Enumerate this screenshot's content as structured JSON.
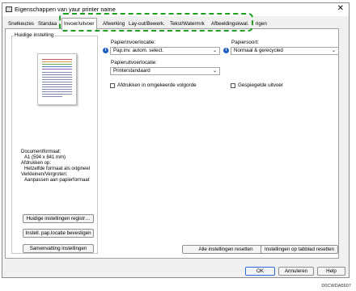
{
  "window": {
    "title": "Eigenschappen van уаur printer name",
    "close_symbol": "✕"
  },
  "tabs": [
    {
      "label": "Snelkeuzes"
    },
    {
      "label": "Standaa"
    },
    {
      "label": "Invoer/uitvoer"
    },
    {
      "label": "Afwerking"
    },
    {
      "label": "Lay-out/Bewerk."
    },
    {
      "label": "Tekst/Watermrk"
    },
    {
      "label": "Afbeeldingskwal."
    },
    {
      "label": "rigen"
    }
  ],
  "left": {
    "group_label": "Huidige instelling",
    "doc_format_label": "Documentformaat:",
    "doc_format_value": "A1 (594 x 841 mm)",
    "print_on_label": "Afdrukken op:",
    "print_on_value": "Hetzelfde formaat als origineel",
    "zoom_label": "Verkleinen/Vergroten:",
    "zoom_value": "Aanpassen aan papierformaat",
    "btn_register": "Huidige instellingen registr…",
    "btn_confirm": "Instell. pap.locatie bevestigen",
    "btn_summary": "Samenvatting instellingen"
  },
  "right": {
    "paper_input_label": "Papierinvoerlocatie:",
    "paper_input_value": "Pap.inv. autom. select.",
    "paper_type_label": "Papiersoort:",
    "paper_type_value": "Normaal & gerecycled",
    "paper_output_label": "Papieruitvoerlocatie:",
    "paper_output_value": "Printerstandaard",
    "reverse_order_label": "Afdrukken in omgekeerde volgorde",
    "mirror_label": "Gespiegelde uitvoer",
    "btn_reset_all": "Alle instellingen resetten",
    "btn_reset_tab": "Instellingen op tabblad resetten"
  },
  "dialog_buttons": {
    "ok": "OK",
    "cancel": "Annuleren",
    "help": "Help"
  },
  "footer_code": "D0CWDA5607",
  "colors": {
    "highlight": "#20a020",
    "info_icon": "#1f5fbf"
  },
  "icons": {
    "info": "info-icon",
    "chevron": "chevron-down-icon",
    "app": "printer-icon"
  }
}
